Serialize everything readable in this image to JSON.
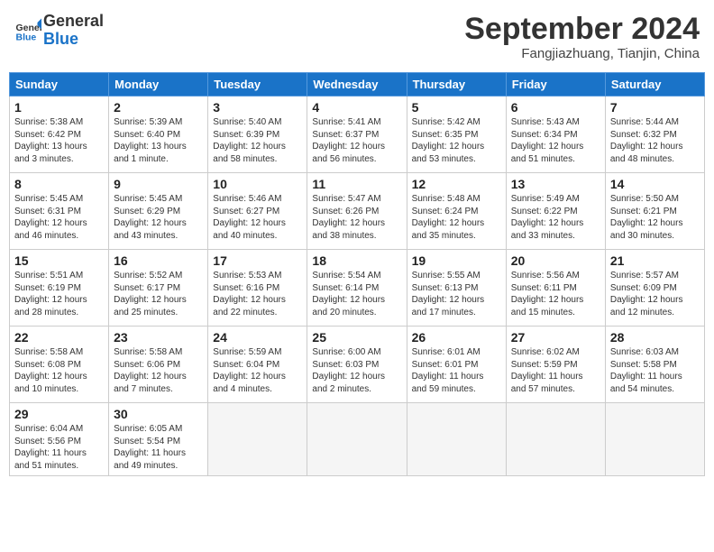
{
  "header": {
    "logo_line1": "General",
    "logo_line2": "Blue",
    "month_title": "September 2024",
    "subtitle": "Fangjiazhuang, Tianjin, China"
  },
  "days_of_week": [
    "Sunday",
    "Monday",
    "Tuesday",
    "Wednesday",
    "Thursday",
    "Friday",
    "Saturday"
  ],
  "weeks": [
    [
      {
        "day": "1",
        "info": "Sunrise: 5:38 AM\nSunset: 6:42 PM\nDaylight: 13 hours\nand 3 minutes."
      },
      {
        "day": "2",
        "info": "Sunrise: 5:39 AM\nSunset: 6:40 PM\nDaylight: 13 hours\nand 1 minute."
      },
      {
        "day": "3",
        "info": "Sunrise: 5:40 AM\nSunset: 6:39 PM\nDaylight: 12 hours\nand 58 minutes."
      },
      {
        "day": "4",
        "info": "Sunrise: 5:41 AM\nSunset: 6:37 PM\nDaylight: 12 hours\nand 56 minutes."
      },
      {
        "day": "5",
        "info": "Sunrise: 5:42 AM\nSunset: 6:35 PM\nDaylight: 12 hours\nand 53 minutes."
      },
      {
        "day": "6",
        "info": "Sunrise: 5:43 AM\nSunset: 6:34 PM\nDaylight: 12 hours\nand 51 minutes."
      },
      {
        "day": "7",
        "info": "Sunrise: 5:44 AM\nSunset: 6:32 PM\nDaylight: 12 hours\nand 48 minutes."
      }
    ],
    [
      {
        "day": "8",
        "info": "Sunrise: 5:45 AM\nSunset: 6:31 PM\nDaylight: 12 hours\nand 46 minutes."
      },
      {
        "day": "9",
        "info": "Sunrise: 5:45 AM\nSunset: 6:29 PM\nDaylight: 12 hours\nand 43 minutes."
      },
      {
        "day": "10",
        "info": "Sunrise: 5:46 AM\nSunset: 6:27 PM\nDaylight: 12 hours\nand 40 minutes."
      },
      {
        "day": "11",
        "info": "Sunrise: 5:47 AM\nSunset: 6:26 PM\nDaylight: 12 hours\nand 38 minutes."
      },
      {
        "day": "12",
        "info": "Sunrise: 5:48 AM\nSunset: 6:24 PM\nDaylight: 12 hours\nand 35 minutes."
      },
      {
        "day": "13",
        "info": "Sunrise: 5:49 AM\nSunset: 6:22 PM\nDaylight: 12 hours\nand 33 minutes."
      },
      {
        "day": "14",
        "info": "Sunrise: 5:50 AM\nSunset: 6:21 PM\nDaylight: 12 hours\nand 30 minutes."
      }
    ],
    [
      {
        "day": "15",
        "info": "Sunrise: 5:51 AM\nSunset: 6:19 PM\nDaylight: 12 hours\nand 28 minutes."
      },
      {
        "day": "16",
        "info": "Sunrise: 5:52 AM\nSunset: 6:17 PM\nDaylight: 12 hours\nand 25 minutes."
      },
      {
        "day": "17",
        "info": "Sunrise: 5:53 AM\nSunset: 6:16 PM\nDaylight: 12 hours\nand 22 minutes."
      },
      {
        "day": "18",
        "info": "Sunrise: 5:54 AM\nSunset: 6:14 PM\nDaylight: 12 hours\nand 20 minutes."
      },
      {
        "day": "19",
        "info": "Sunrise: 5:55 AM\nSunset: 6:13 PM\nDaylight: 12 hours\nand 17 minutes."
      },
      {
        "day": "20",
        "info": "Sunrise: 5:56 AM\nSunset: 6:11 PM\nDaylight: 12 hours\nand 15 minutes."
      },
      {
        "day": "21",
        "info": "Sunrise: 5:57 AM\nSunset: 6:09 PM\nDaylight: 12 hours\nand 12 minutes."
      }
    ],
    [
      {
        "day": "22",
        "info": "Sunrise: 5:58 AM\nSunset: 6:08 PM\nDaylight: 12 hours\nand 10 minutes."
      },
      {
        "day": "23",
        "info": "Sunrise: 5:58 AM\nSunset: 6:06 PM\nDaylight: 12 hours\nand 7 minutes."
      },
      {
        "day": "24",
        "info": "Sunrise: 5:59 AM\nSunset: 6:04 PM\nDaylight: 12 hours\nand 4 minutes."
      },
      {
        "day": "25",
        "info": "Sunrise: 6:00 AM\nSunset: 6:03 PM\nDaylight: 12 hours\nand 2 minutes."
      },
      {
        "day": "26",
        "info": "Sunrise: 6:01 AM\nSunset: 6:01 PM\nDaylight: 11 hours\nand 59 minutes."
      },
      {
        "day": "27",
        "info": "Sunrise: 6:02 AM\nSunset: 5:59 PM\nDaylight: 11 hours\nand 57 minutes."
      },
      {
        "day": "28",
        "info": "Sunrise: 6:03 AM\nSunset: 5:58 PM\nDaylight: 11 hours\nand 54 minutes."
      }
    ],
    [
      {
        "day": "29",
        "info": "Sunrise: 6:04 AM\nSunset: 5:56 PM\nDaylight: 11 hours\nand 51 minutes."
      },
      {
        "day": "30",
        "info": "Sunrise: 6:05 AM\nSunset: 5:54 PM\nDaylight: 11 hours\nand 49 minutes."
      },
      {
        "day": "",
        "info": ""
      },
      {
        "day": "",
        "info": ""
      },
      {
        "day": "",
        "info": ""
      },
      {
        "day": "",
        "info": ""
      },
      {
        "day": "",
        "info": ""
      }
    ]
  ]
}
